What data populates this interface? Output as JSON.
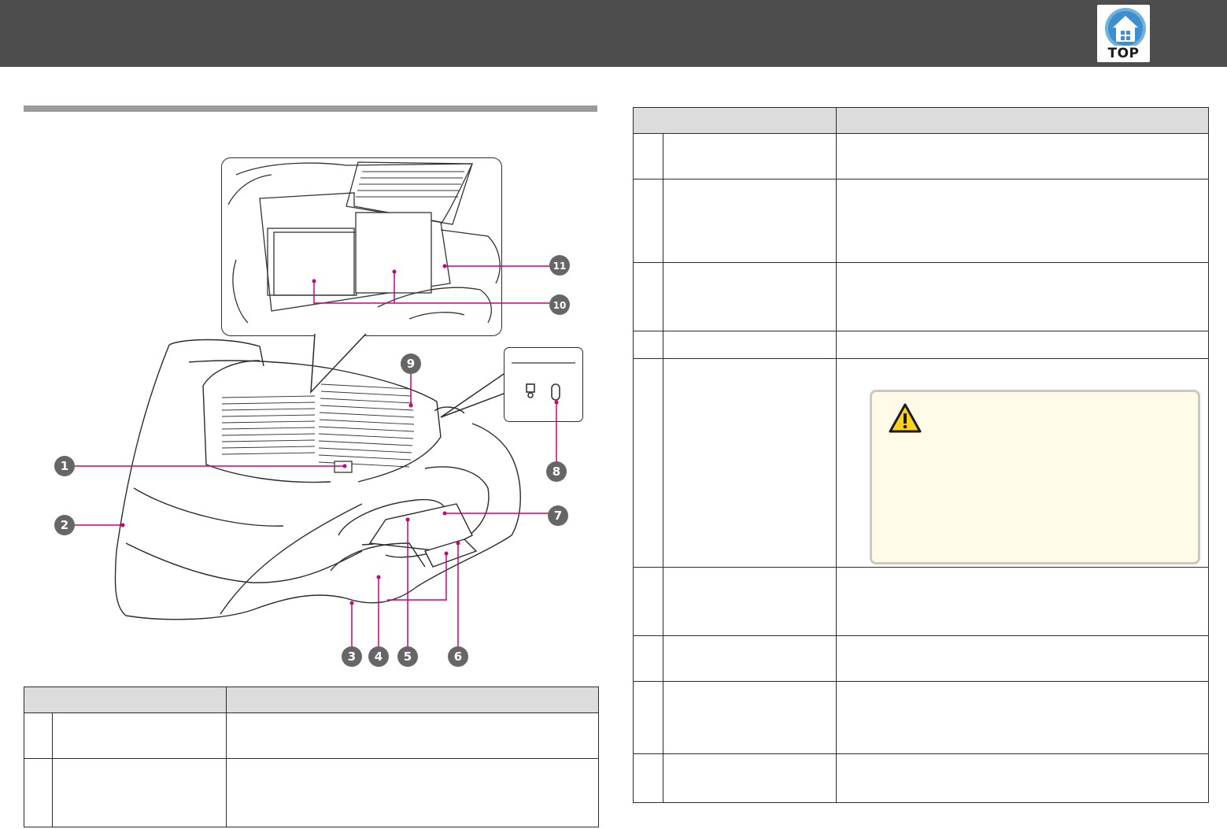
{
  "header": {
    "top_button_label": "TOP",
    "top_button_icon": "home-icon",
    "accent_color": "#cc007a",
    "bar_color": "#4d4d4d"
  },
  "figure": {
    "callout_numbers": [
      "1",
      "2",
      "3",
      "4",
      "5",
      "6",
      "7",
      "8",
      "9",
      "10",
      "11"
    ],
    "detail_icons": [
      "security-slot-icon",
      "security-cable-hole-icon"
    ]
  },
  "table_left": {
    "headers": [
      "",
      ""
    ],
    "rows": [
      {
        "num": "",
        "name": "",
        "function": ""
      },
      {
        "num": "",
        "name": "",
        "function": ""
      }
    ]
  },
  "table_right": {
    "headers": [
      "",
      ""
    ],
    "rows": [
      {
        "num": "",
        "name": "",
        "function": ""
      },
      {
        "num": "",
        "name": "",
        "function": ""
      },
      {
        "num": "",
        "name": "",
        "function": ""
      },
      {
        "num": "",
        "name": "",
        "function": ""
      },
      {
        "num": "",
        "name": "",
        "function": "",
        "caution_icon": "warning-icon"
      },
      {
        "num": "",
        "name": "",
        "function": ""
      },
      {
        "num": "",
        "name": "",
        "function": ""
      },
      {
        "num": "",
        "name": "",
        "function": ""
      },
      {
        "num": "",
        "name": "",
        "function": ""
      }
    ]
  }
}
